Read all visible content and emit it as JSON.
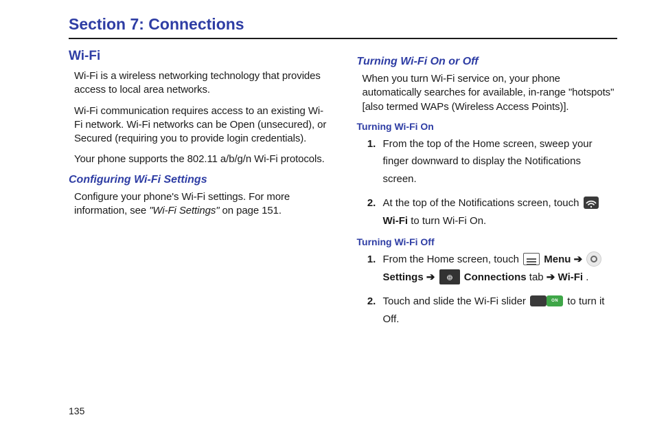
{
  "section_title": "Section 7: Connections",
  "page_number": "135",
  "left": {
    "h2": "Wi-Fi",
    "p1": "Wi-Fi is a wireless networking technology that provides access to local area networks.",
    "p2": "Wi-Fi communication requires access to an existing Wi-Fi network. Wi-Fi networks can be Open (unsecured), or Secured (requiring you to provide login credentials).",
    "p3": "Your phone supports the 802.11 a/b/g/n Wi-Fi protocols.",
    "h3": "Configuring Wi-Fi Settings",
    "p4_a": "Configure your phone's Wi-Fi settings. For more information, see ",
    "p4_ref": "\"Wi-Fi Settings\"",
    "p4_b": " on page 151."
  },
  "right": {
    "h3": "Turning Wi-Fi On or Off",
    "p1": "When you turn Wi-Fi service on, your phone automatically searches for available, in-range \"hotspots\" [also termed WAPs (Wireless Access Points)].",
    "on": {
      "h4": "Turning Wi-Fi On",
      "s1": "From the top of the Home screen, sweep your finger downward to display the Notifications screen.",
      "s2_a": "At the top of the Notifications screen, touch ",
      "s2_wifi": "Wi-Fi",
      "s2_b": " to turn Wi-Fi On."
    },
    "off": {
      "h4": "Turning Wi-Fi Off",
      "s1_a": "From the Home screen, touch ",
      "s1_menu": "Menu",
      "s1_arrow1": " ➔ ",
      "s1_settings": "Settings",
      "s1_arrow2": " ➔ ",
      "s1_connections": "Connections",
      "s1_tab": " tab ",
      "s1_arrow3": "➔ ",
      "s1_wifi": "Wi-Fi",
      "s1_end": " .",
      "s2_a": "Touch and slide the Wi-Fi slider ",
      "s2_b": " to turn it Off.",
      "slider_label": "ON"
    }
  }
}
